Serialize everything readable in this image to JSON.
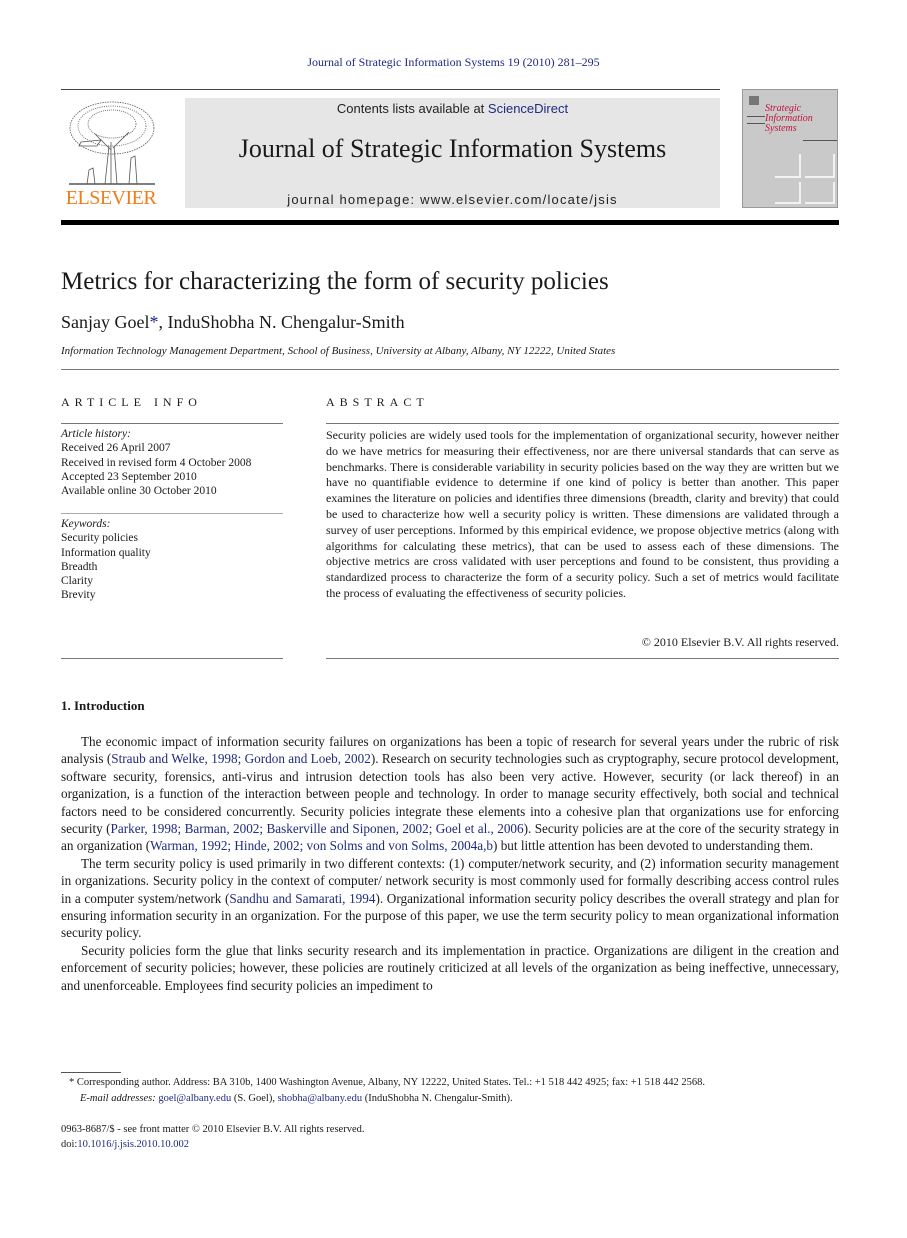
{
  "running_head": "Journal of Strategic Information Systems 19 (2010) 281–295",
  "masthead": {
    "publisher_logo_text": "ELSEVIER",
    "contents_prefix": "Contents lists available at ",
    "contents_link": "ScienceDirect",
    "journal_title": "Journal of Strategic Information Systems",
    "homepage_label": "journal homepage: ",
    "homepage_url": "www.elsevier.com/locate/jsis",
    "cover_title_lines": [
      "Strategic",
      "Information",
      "Systems"
    ]
  },
  "article": {
    "title": "Metrics for characterizing the form of security policies",
    "author_1": "Sanjay Goel",
    "author_1_mark": "*",
    "author_separator": ", ",
    "author_2": "InduShobha N. Chengalur-Smith",
    "affiliation": "Information Technology Management Department, School of Business, University at Albany, Albany, NY 12222, United States"
  },
  "article_info": {
    "label": "ARTICLE INFO",
    "history_heading": "Article history:",
    "history": [
      "Received 26 April 2007",
      "Received in revised form 4 October 2008",
      "Accepted 23 September 2010",
      "Available online 30 October 2010"
    ],
    "keywords_heading": "Keywords:",
    "keywords": [
      "Security policies",
      "Information quality",
      "Breadth",
      "Clarity",
      "Brevity"
    ]
  },
  "abstract": {
    "label": "ABSTRACT",
    "text": "Security policies are widely used tools for the implementation of organizational security, however neither do we have metrics for measuring their effectiveness, nor are there universal standards that can serve as benchmarks. There is considerable variability in security policies based on the way they are written but we have no quantifiable evidence to determine if one kind of policy is better than another. This paper examines the literature on policies and identifies three dimensions (breadth, clarity and brevity) that could be used to characterize how well a security policy is written. These dimensions are validated through a survey of user perceptions. Informed by this empirical evidence, we propose objective metrics (along with algorithms for calculating these metrics), that can be used to assess each of these dimensions. The objective metrics are cross validated with user perceptions and found to be consistent, thus providing a standardized process to characterize the form of a security policy. Such a set of metrics would facilitate the process of evaluating the effectiveness of security policies.",
    "copyright": "© 2010 Elsevier B.V. All rights reserved."
  },
  "introduction": {
    "heading": "1. Introduction",
    "p1": {
      "t1": "The economic impact of information security failures on organizations has been a topic of research for several years under the rubric of risk analysis (",
      "c1": "Straub and Welke, 1998; Gordon and Loeb, 2002",
      "t2": "). Research on security technologies such as cryptography, secure protocol development, software security, forensics, anti-virus and intrusion detection tools has also been very active. However, security (or lack thereof) in an organization, is a function of the interaction between people and technology. In order to manage security effectively, both social and technical factors need to be considered concurrently. Security policies integrate these elements into a cohesive plan that organizations use for enforcing security (",
      "c2": "Parker, 1998; Barman, 2002; Baskerville and Siponen, 2002; Goel et al., 2006",
      "t3": "). Security policies are at the core of the security strategy in an organization (",
      "c3": "Warman, 1992; Hinde, 2002; von Solms and von Solms, 2004a,b",
      "t4": ") but little attention has been devoted to understanding them."
    },
    "p2": {
      "t1": "The term security policy is used primarily in two different contexts: (1) computer/network security, and (2) information security management in organizations. Security policy in the context of computer/ network security is most commonly used for formally describing access control rules in a computer system/network (",
      "c1": "Sandhu and Samarati, 1994",
      "t2": "). Organizational information security policy describes the overall strategy and plan for ensuring information security in an organization. For the purpose of this paper, we use the term security policy to mean organizational information security policy."
    },
    "p3": "Security policies form the glue that links security research and its implementation in practice. Organizations are diligent in the creation and enforcement of security policies; however, these policies are routinely criticized at all levels of the organization as being ineffective, unnecessary, and unenforceable. Employees find security policies an impediment to"
  },
  "footnote": {
    "mark": "*",
    "corresponding": " Corresponding author. Address: BA 310b, 1400 Washington Avenue, Albany, NY 12222, United States. Tel.: +1 518 442 4925; fax: +1 518 442 2568.",
    "email_label": "E-mail addresses:",
    "email_1": "goel@albany.edu",
    "email_1_owner": " (S. Goel), ",
    "email_2": "shobha@albany.edu",
    "email_2_owner": " (InduShobha N. Chengalur-Smith)."
  },
  "front_matter": {
    "issn_line": "0963-8687/$ - see front matter © 2010 Elsevier B.V. All rights reserved.",
    "doi_label": "doi:",
    "doi": "10.1016/j.jsis.2010.10.002"
  }
}
